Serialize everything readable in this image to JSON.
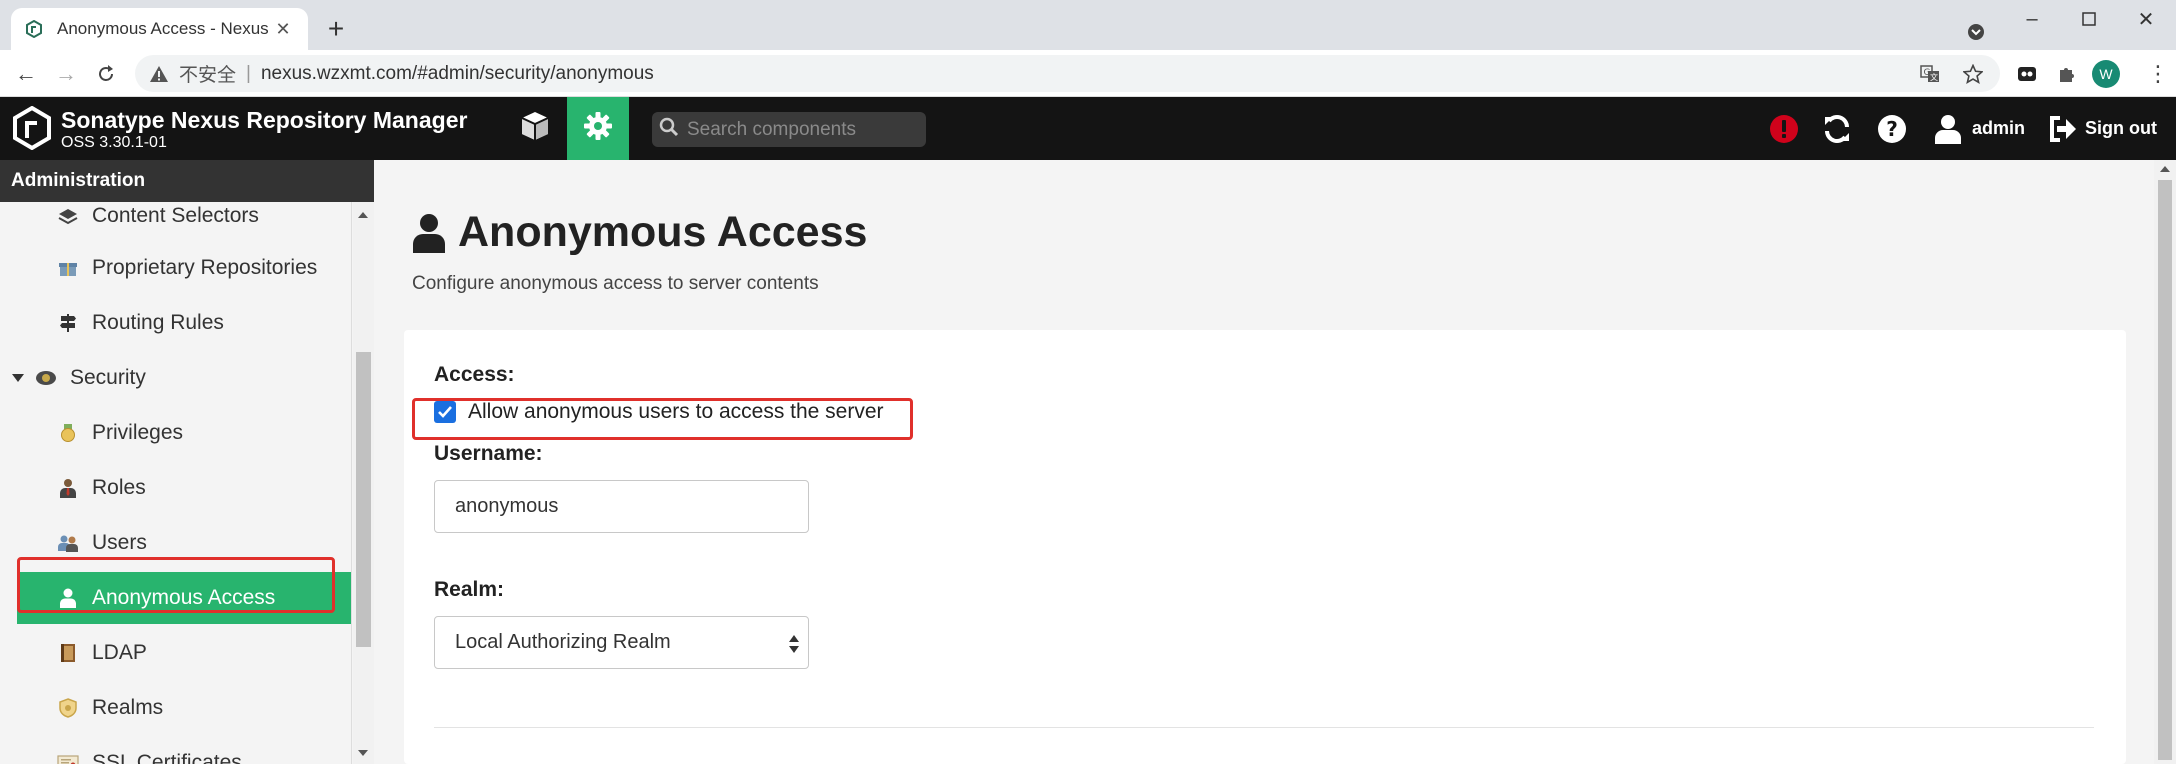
{
  "browser": {
    "tab_title": "Anonymous Access - Nexus Re",
    "url_insecure_label": "不安全",
    "url_separator": "|",
    "url": "nexus.wzxmt.com/#admin/security/anonymous",
    "profile_initial": "W"
  },
  "header": {
    "app_title": "Sonatype Nexus Repository Manager",
    "version": "OSS 3.30.1-01",
    "search_placeholder": "Search components",
    "username": "admin",
    "signout_label": "Sign out",
    "accent_color": "#28b46e",
    "alert_color": "#d0021b"
  },
  "sidebar": {
    "heading": "Administration",
    "items": [
      {
        "label": "Content Selectors",
        "icon": "layers-icon"
      },
      {
        "label": "Proprietary Repositories",
        "icon": "gift-icon"
      },
      {
        "label": "Routing Rules",
        "icon": "signpost-icon"
      },
      {
        "label": "Security",
        "icon": "badge-icon",
        "expanded": true
      },
      {
        "label": "Privileges",
        "icon": "medal-icon"
      },
      {
        "label": "Roles",
        "icon": "user-tie-icon"
      },
      {
        "label": "Users",
        "icon": "users-icon"
      },
      {
        "label": "Anonymous Access",
        "icon": "user-icon",
        "active": true
      },
      {
        "label": "LDAP",
        "icon": "book-icon"
      },
      {
        "label": "Realms",
        "icon": "shield-icon"
      },
      {
        "label": "SSL Certificates",
        "icon": "certificate-icon"
      }
    ]
  },
  "main": {
    "title": "Anonymous Access",
    "subtitle": "Configure anonymous access to server contents",
    "access_label": "Access:",
    "checkbox_label": "Allow anonymous users to access the server",
    "checkbox_checked": true,
    "username_label": "Username:",
    "username_value": "anonymous",
    "realm_label": "Realm:",
    "realm_value": "Local Authorizing Realm",
    "highlight_color": "#e0302b"
  }
}
